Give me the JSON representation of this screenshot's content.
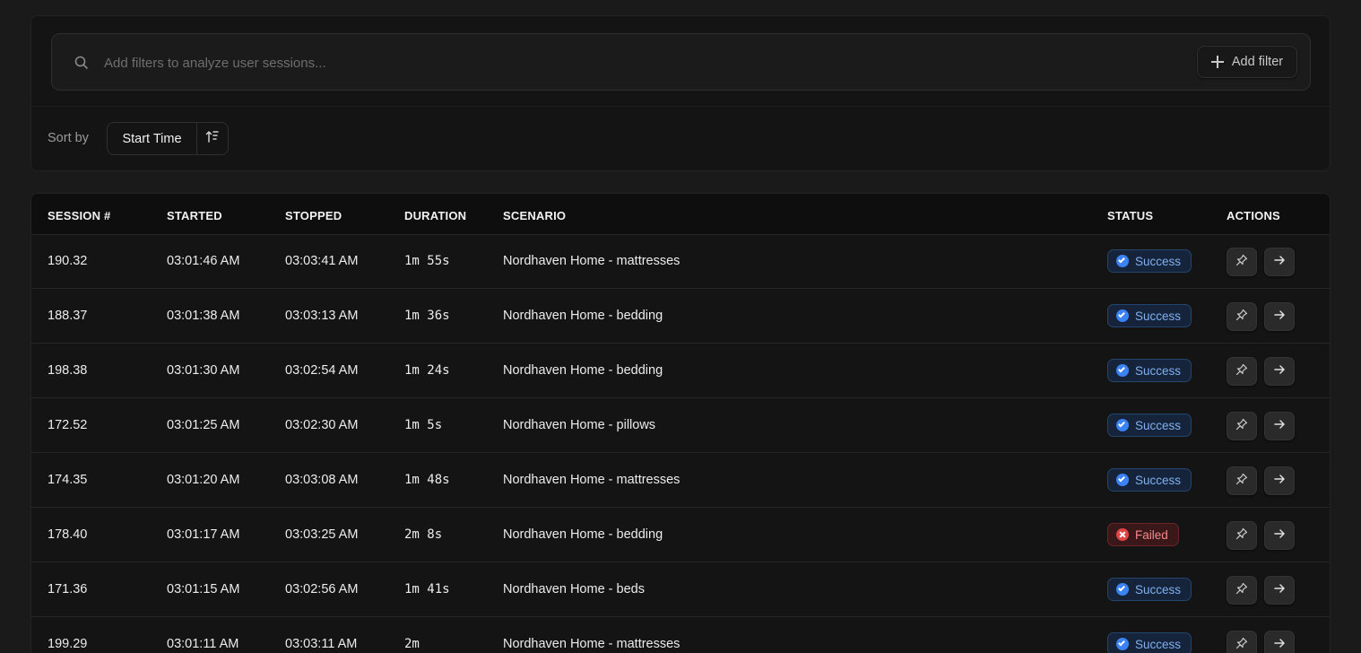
{
  "filters": {
    "search_placeholder": "Add filters to analyze user sessions...",
    "add_filter_label": "Add filter",
    "sort_label": "Sort by",
    "sort_field": "Start Time"
  },
  "table": {
    "headers": {
      "session": "SESSION #",
      "started": "STARTED",
      "stopped": "STOPPED",
      "duration": "DURATION",
      "scenario": "SCENARIO",
      "status": "STATUS",
      "actions": "ACTIONS"
    },
    "rows": [
      {
        "session": "190.32",
        "started": "03:01:46 AM",
        "stopped": "03:03:41 AM",
        "duration": "1m 55s",
        "scenario": "Nordhaven Home - mattresses",
        "status": "Success"
      },
      {
        "session": "188.37",
        "started": "03:01:38 AM",
        "stopped": "03:03:13 AM",
        "duration": "1m 36s",
        "scenario": "Nordhaven Home - bedding",
        "status": "Success"
      },
      {
        "session": "198.38",
        "started": "03:01:30 AM",
        "stopped": "03:02:54 AM",
        "duration": "1m 24s",
        "scenario": "Nordhaven Home - bedding",
        "status": "Success"
      },
      {
        "session": "172.52",
        "started": "03:01:25 AM",
        "stopped": "03:02:30 AM",
        "duration": "1m 5s",
        "scenario": "Nordhaven Home - pillows",
        "status": "Success"
      },
      {
        "session": "174.35",
        "started": "03:01:20 AM",
        "stopped": "03:03:08 AM",
        "duration": "1m 48s",
        "scenario": "Nordhaven Home - mattresses",
        "status": "Success"
      },
      {
        "session": "178.40",
        "started": "03:01:17 AM",
        "stopped": "03:03:25 AM",
        "duration": "2m 8s",
        "scenario": "Nordhaven Home - bedding",
        "status": "Failed"
      },
      {
        "session": "171.36",
        "started": "03:01:15 AM",
        "stopped": "03:02:56 AM",
        "duration": "1m 41s",
        "scenario": "Nordhaven Home - beds",
        "status": "Success"
      },
      {
        "session": "199.29",
        "started": "03:01:11 AM",
        "stopped": "03:03:11 AM",
        "duration": "2m",
        "scenario": "Nordhaven Home - mattresses",
        "status": "Success"
      }
    ]
  },
  "colors": {
    "success": "#3b82f6",
    "failed": "#e04444",
    "background": "#1a1a1a"
  },
  "icons": {
    "search": "search-icon",
    "add": "plus-icon",
    "sort_direction": "sort-direction-icon",
    "pin": "pin-icon",
    "open": "arrow-right-icon"
  }
}
